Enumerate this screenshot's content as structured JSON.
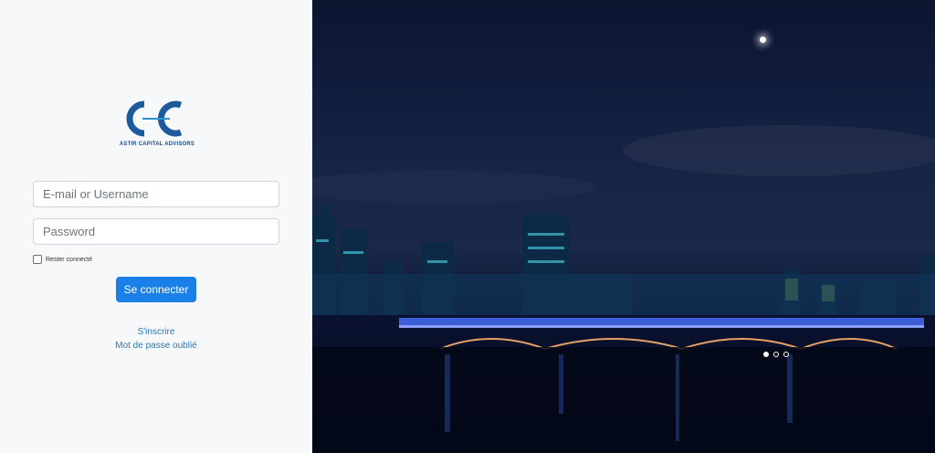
{
  "brand": {
    "logo_text": "ASTIR CAPITAL ADVISORS",
    "color": "#1b5b9c"
  },
  "login_form": {
    "email_placeholder": "E-mail or Username",
    "password_placeholder": "Password",
    "remember_label": "Rester connecté",
    "submit_label": "Se connecter",
    "signup_link": "S'inscrire",
    "forgot_link": "Mot de passe oublié"
  },
  "carousel": {
    "slide_count": 3,
    "active_index": 0
  },
  "colors": {
    "primary_button": "#1a7fe6",
    "link": "#2a7ab8"
  }
}
